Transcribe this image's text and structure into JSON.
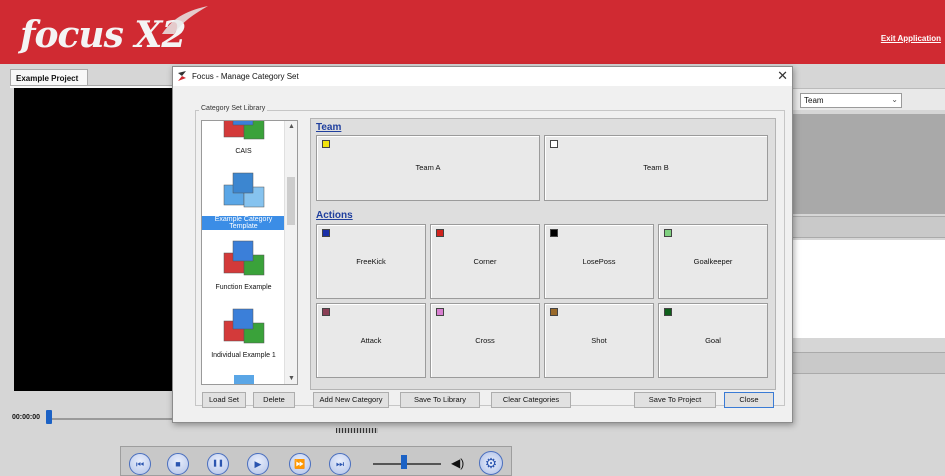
{
  "app": {
    "logo_text": "focus X2",
    "exit_label": "Exit Application"
  },
  "left": {
    "project_tab": "Example Project",
    "time": "00:00:00"
  },
  "right": {
    "team_select": "Team"
  },
  "transport": {
    "buttons": [
      {
        "name": "skip-start-icon",
        "glyph": "⏮"
      },
      {
        "name": "stop-icon",
        "glyph": "■"
      },
      {
        "name": "pause-icon",
        "glyph": "❚❚"
      },
      {
        "name": "play-icon",
        "glyph": "▶"
      },
      {
        "name": "fast-forward-icon",
        "glyph": "⏩"
      },
      {
        "name": "skip-end-icon",
        "glyph": "⏭"
      }
    ],
    "volume_fraction": 0.45,
    "speaker_glyph": "◀)",
    "settings_glyph": "⚙"
  },
  "dialog": {
    "title": "Focus - Manage Category Set",
    "close_glyph": "✕",
    "library_label": "Category Set Library",
    "library_items": [
      {
        "label": "CAIS",
        "selected": false,
        "colors": [
          "#d33a3a",
          "#3aa23a",
          "#3b7fd9"
        ]
      },
      {
        "label": "Example Category Template",
        "selected": true,
        "colors": [
          "#5aa6e6",
          "#86c3ef",
          "#3c86d0"
        ]
      },
      {
        "label": "Function Example",
        "selected": false,
        "colors": [
          "#d33a3a",
          "#3aa23a",
          "#3b7fd9"
        ]
      },
      {
        "label": "Individual Example 1",
        "selected": false,
        "colors": [
          "#d33a3a",
          "#3aa23a",
          "#3b7fd9"
        ]
      }
    ],
    "buttons": {
      "load_set": "Load Set",
      "delete": "Delete",
      "add_new_category": "Add New Category",
      "save_to_library": "Save To Library",
      "clear_categories": "Clear Categories",
      "save_to_project": "Save To Project",
      "close": "Close"
    },
    "sections": {
      "team": {
        "title": "Team",
        "items": [
          {
            "label": "Team A",
            "color": "#f3e40c"
          },
          {
            "label": "Team B",
            "color": "#ffffff"
          }
        ]
      },
      "actions": {
        "title": "Actions",
        "items": [
          {
            "label": "FreeKick",
            "color": "#1a2fa8"
          },
          {
            "label": "Corner",
            "color": "#d0231d"
          },
          {
            "label": "LosePoss",
            "color": "#000000"
          },
          {
            "label": "Goalkeeper",
            "color": "#7fd07f"
          },
          {
            "label": "Attack",
            "color": "#8a3f55"
          },
          {
            "label": "Cross",
            "color": "#d87fd0"
          },
          {
            "label": "Shot",
            "color": "#9a6a2a"
          },
          {
            "label": "Goal",
            "color": "#0e5e1a"
          }
        ]
      }
    }
  }
}
